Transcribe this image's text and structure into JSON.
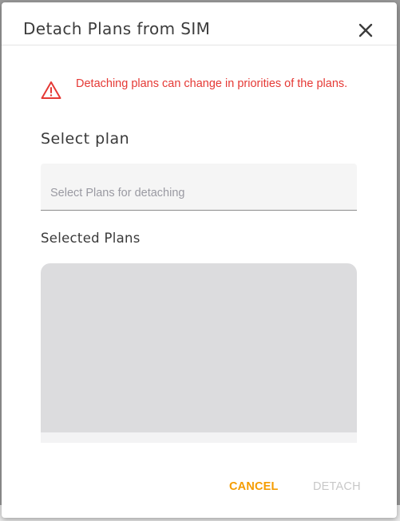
{
  "dialog": {
    "title": "Detach Plans from SIM",
    "close_icon": "close-icon",
    "warning": {
      "icon": "warning-triangle-icon",
      "text": "Detaching plans can change in priorities of the plans.",
      "color": "#e53935"
    },
    "select_plan": {
      "label": "Select plan",
      "placeholder": "Select Plans for detaching",
      "value": ""
    },
    "selected_plans": {
      "label": "Selected Plans",
      "items": []
    },
    "actions": {
      "cancel_label": "CANCEL",
      "cancel_color": "#f59c00",
      "detach_label": "DETACH",
      "detach_enabled": false
    }
  }
}
